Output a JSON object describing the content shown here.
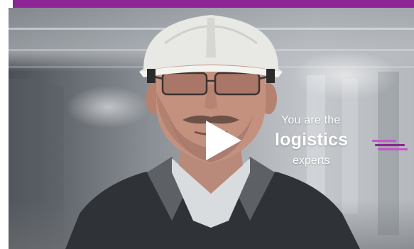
{
  "colors": {
    "accent": "#8e2596",
    "accent_light": "#c455cc",
    "overlay_text": "#ffffff",
    "play_icon": "#ffffff"
  },
  "video": {
    "headline": {
      "line1": "You are the",
      "line2": "logistics",
      "line3": "experts"
    },
    "play_icon": "play-icon"
  }
}
